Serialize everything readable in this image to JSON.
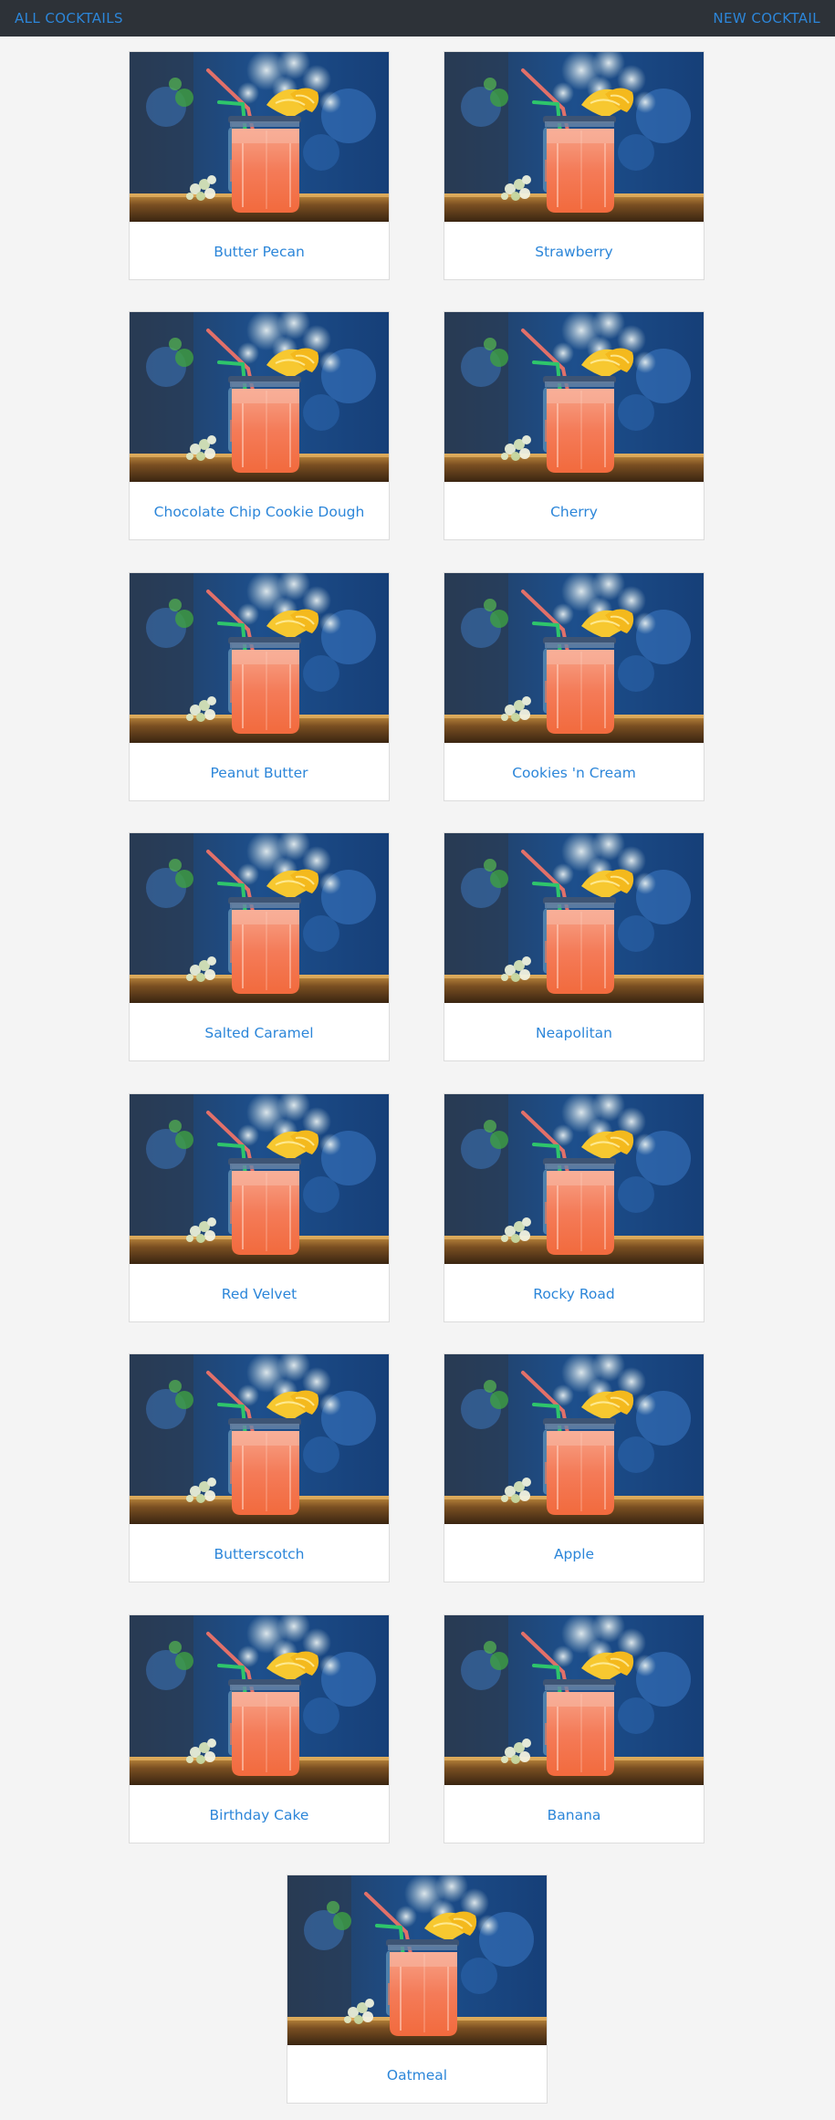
{
  "nav": {
    "all_cocktails_label": "ALL COCKTAILS",
    "new_cocktail_label": "NEW COCKTAIL"
  },
  "cocktails": [
    {
      "name": "Butter Pecan"
    },
    {
      "name": "Strawberry"
    },
    {
      "name": "Chocolate Chip Cookie Dough"
    },
    {
      "name": "Cherry"
    },
    {
      "name": "Peanut Butter"
    },
    {
      "name": "Cookies 'n Cream"
    },
    {
      "name": "Salted Caramel"
    },
    {
      "name": "Neapolitan"
    },
    {
      "name": "Red Velvet"
    },
    {
      "name": "Rocky Road"
    },
    {
      "name": "Butterscotch"
    },
    {
      "name": "Apple"
    },
    {
      "name": "Birthday Cake"
    },
    {
      "name": "Banana"
    },
    {
      "name": "Oatmeal"
    }
  ],
  "colors": {
    "navbar": "#2d3238",
    "link": "#2c86d9",
    "page_background": "#f4f4f4"
  }
}
